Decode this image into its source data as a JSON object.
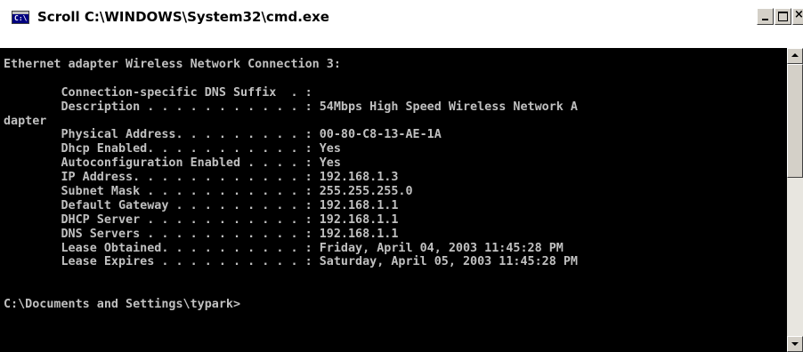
{
  "window": {
    "title": "Scroll C:\\WINDOWS\\System32\\cmd.exe",
    "icon": "cmd-icon",
    "icon_glyph": "C:\\",
    "controls": {
      "minimize": "_",
      "maximize": "□",
      "close": "×"
    }
  },
  "console": {
    "background": "#000000",
    "foreground": "#c0c0c0",
    "lines": [
      "Ethernet adapter Wireless Network Connection 3:",
      "",
      "        Connection-specific DNS Suffix  . :",
      "        Description . . . . . . . . . . . : 54Mbps High Speed Wireless Network A",
      "dapter",
      "        Physical Address. . . . . . . . . : 00-80-C8-13-AE-1A",
      "        Dhcp Enabled. . . . . . . . . . . : Yes",
      "        Autoconfiguration Enabled . . . . : Yes",
      "        IP Address. . . . . . . . . . . . : 192.168.1.3",
      "        Subnet Mask . . . . . . . . . . . : 255.255.255.0",
      "        Default Gateway . . . . . . . . . : 192.168.1.1",
      "        DHCP Server . . . . . . . . . . . : 192.168.1.1",
      "        DNS Servers . . . . . . . . . . . : 192.168.1.1",
      "        Lease Obtained. . . . . . . . . . : Friday, April 04, 2003 11:45:28 PM",
      "        Lease Expires . . . . . . . . . . : Saturday, April 05, 2003 11:45:28 PM",
      "",
      "",
      "C:\\Documents and Settings\\typark>"
    ]
  },
  "scrollbar": {
    "up_icon": "arrow-up-icon",
    "down_icon": "arrow-down-icon"
  }
}
